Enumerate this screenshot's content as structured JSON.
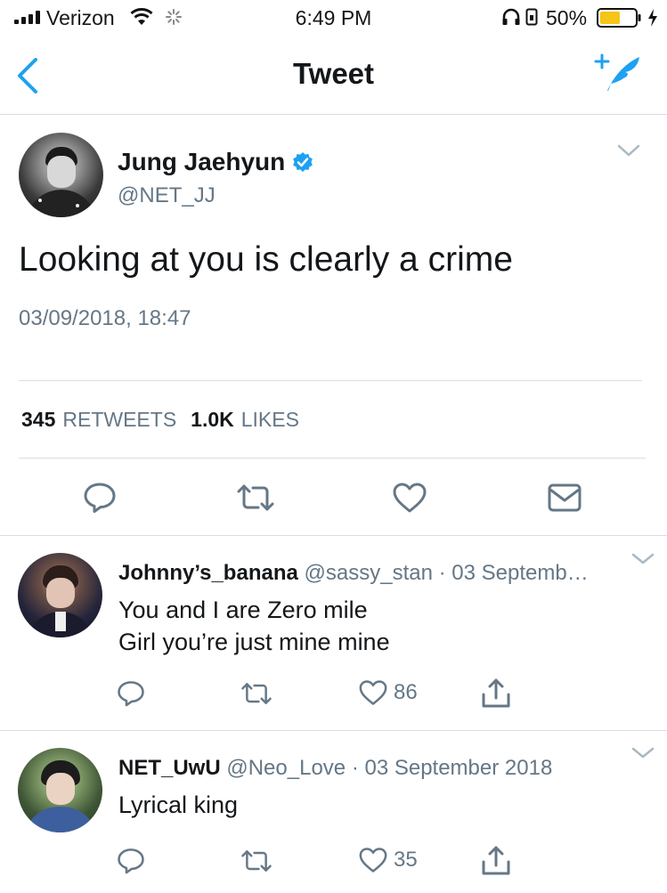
{
  "status_bar": {
    "carrier": "Verizon",
    "time": "6:49 PM",
    "battery_percent": "50%"
  },
  "nav": {
    "title": "Tweet"
  },
  "tweet": {
    "author_name": "Jung Jaehyun",
    "author_handle": "@NET_JJ",
    "verified": true,
    "text": "Looking at you is clearly a crime",
    "timestamp": "03/09/2018, 18:47",
    "retweets_count": "345",
    "retweets_label": "RETWEETS",
    "likes_count": "1.0K",
    "likes_label": "LIKES"
  },
  "replies": [
    {
      "name": "Johnny’s_banana",
      "handle": "@sassy_stan",
      "date": "· 03 Septemb…",
      "lines": [
        "You and I are Zero mile",
        "Girl you’re just mine mine"
      ],
      "likes": "86"
    },
    {
      "name": "NET_UwU",
      "handle": "@Neo_Love",
      "date": "· 03 September 2018",
      "lines": [
        "Lyrical king"
      ],
      "likes": "35"
    }
  ],
  "colors": {
    "accent": "#1da1f2",
    "text": "#14171a",
    "secondary": "#657786",
    "battery": "#f5c518"
  }
}
